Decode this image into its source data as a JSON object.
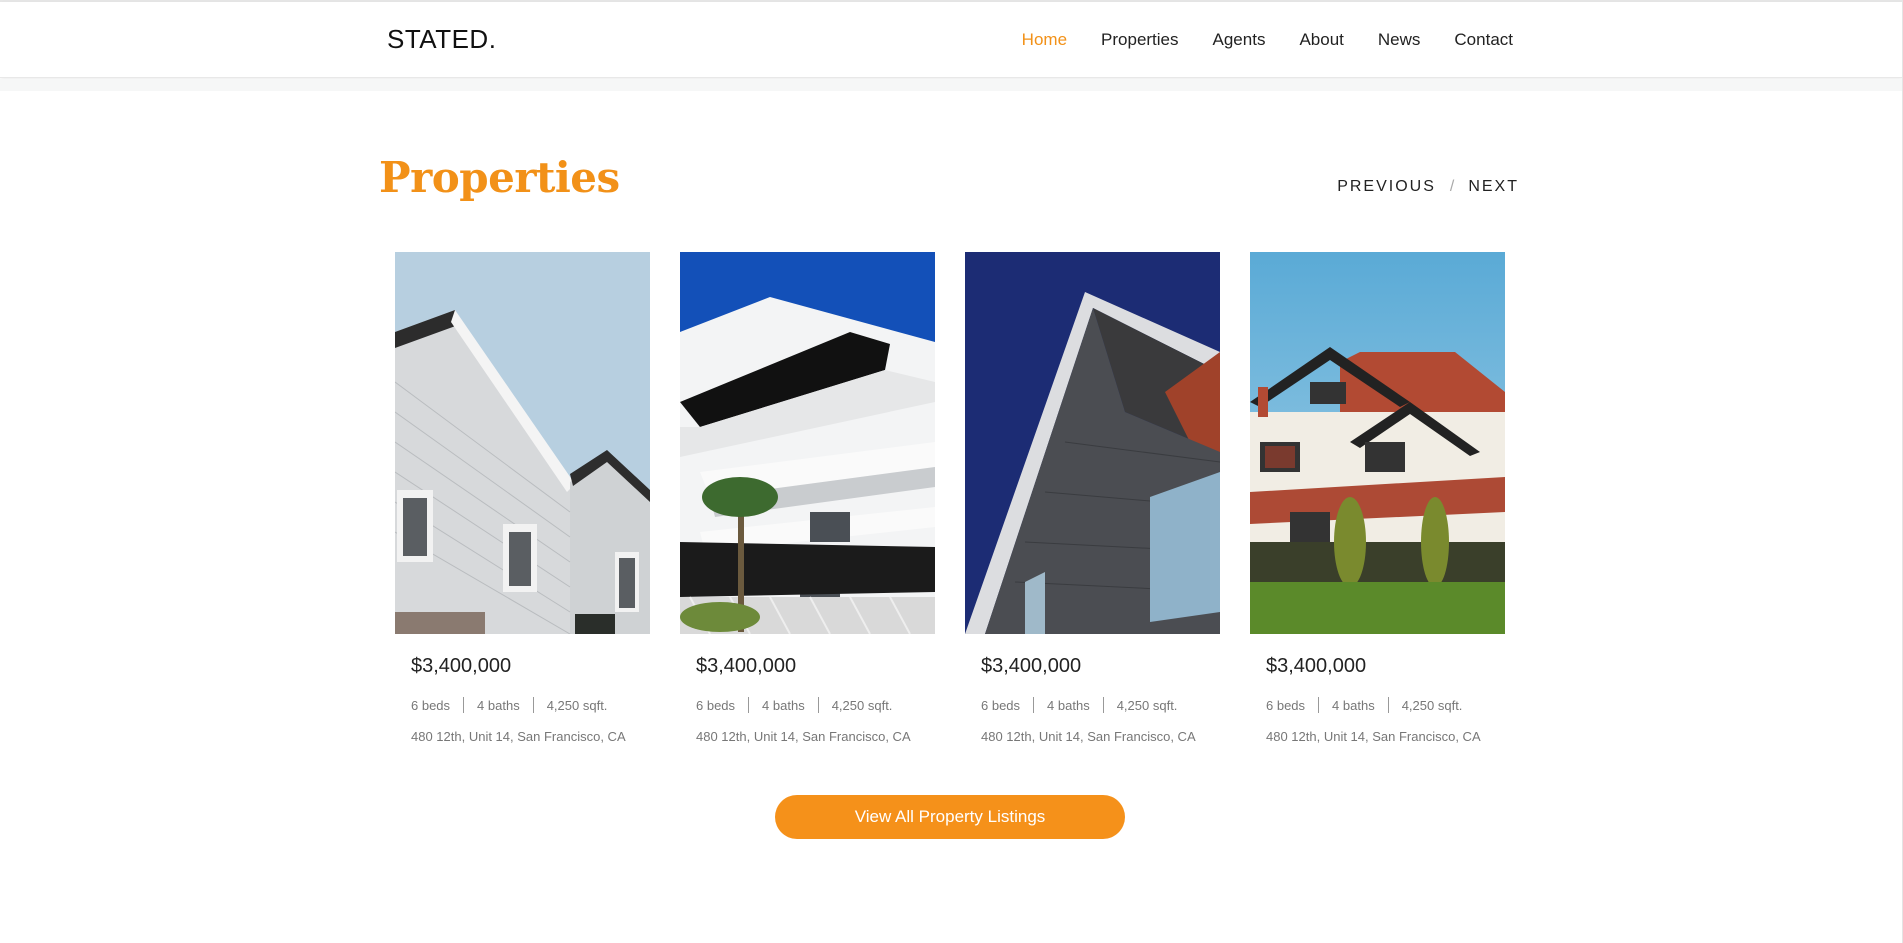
{
  "header": {
    "logo": "STATED.",
    "nav": [
      {
        "label": "Home",
        "active": true
      },
      {
        "label": "Properties",
        "active": false
      },
      {
        "label": "Agents",
        "active": false
      },
      {
        "label": "About",
        "active": false
      },
      {
        "label": "News",
        "active": false
      },
      {
        "label": "Contact",
        "active": false
      }
    ]
  },
  "section": {
    "title": "Properties",
    "previous": "PREVIOUS",
    "separator": "/",
    "next": "NEXT"
  },
  "properties": [
    {
      "price": "$3,400,000",
      "beds": "6 beds",
      "baths": "4 baths",
      "area": "4,250 sqft.",
      "address": "480 12th, Unit 14, San Francisco, CA"
    },
    {
      "price": "$3,400,000",
      "beds": "6 beds",
      "baths": "4 baths",
      "area": "4,250 sqft.",
      "address": "480 12th, Unit 14, San Francisco, CA"
    },
    {
      "price": "$3,400,000",
      "beds": "6 beds",
      "baths": "4 baths",
      "area": "4,250 sqft.",
      "address": "480 12th, Unit 14, San Francisco, CA"
    },
    {
      "price": "$3,400,000",
      "beds": "6 beds",
      "baths": "4 baths",
      "area": "4,250 sqft.",
      "address": "480 12th, Unit 14, San Francisco, CA"
    }
  ],
  "cta": {
    "label": "View All Property Listings"
  },
  "colors": {
    "accent": "#f29118",
    "button": "#f5911a",
    "text": "#222222",
    "muted": "#777777"
  }
}
